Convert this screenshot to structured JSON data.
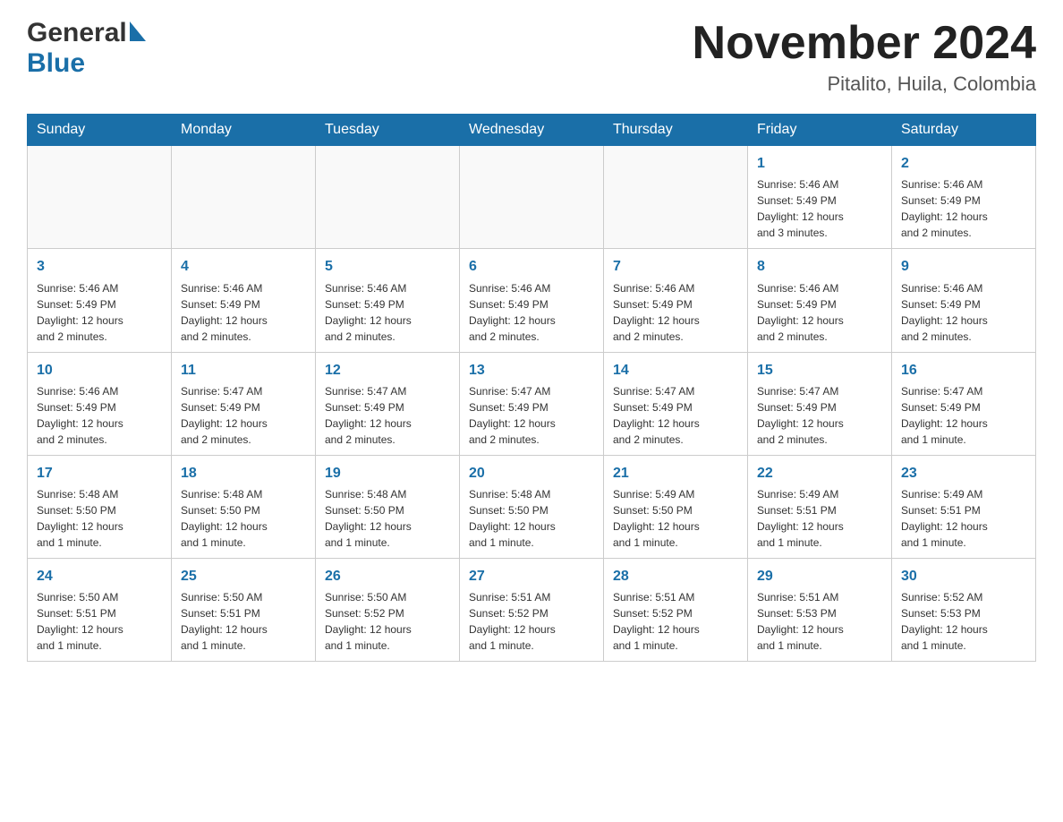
{
  "header": {
    "month_year": "November 2024",
    "location": "Pitalito, Huila, Colombia",
    "logo_general": "General",
    "logo_blue": "Blue"
  },
  "weekdays": [
    "Sunday",
    "Monday",
    "Tuesday",
    "Wednesday",
    "Thursday",
    "Friday",
    "Saturday"
  ],
  "weeks": [
    {
      "days": [
        {
          "num": "",
          "info": ""
        },
        {
          "num": "",
          "info": ""
        },
        {
          "num": "",
          "info": ""
        },
        {
          "num": "",
          "info": ""
        },
        {
          "num": "",
          "info": ""
        },
        {
          "num": "1",
          "info": "Sunrise: 5:46 AM\nSunset: 5:49 PM\nDaylight: 12 hours\nand 3 minutes."
        },
        {
          "num": "2",
          "info": "Sunrise: 5:46 AM\nSunset: 5:49 PM\nDaylight: 12 hours\nand 2 minutes."
        }
      ]
    },
    {
      "days": [
        {
          "num": "3",
          "info": "Sunrise: 5:46 AM\nSunset: 5:49 PM\nDaylight: 12 hours\nand 2 minutes."
        },
        {
          "num": "4",
          "info": "Sunrise: 5:46 AM\nSunset: 5:49 PM\nDaylight: 12 hours\nand 2 minutes."
        },
        {
          "num": "5",
          "info": "Sunrise: 5:46 AM\nSunset: 5:49 PM\nDaylight: 12 hours\nand 2 minutes."
        },
        {
          "num": "6",
          "info": "Sunrise: 5:46 AM\nSunset: 5:49 PM\nDaylight: 12 hours\nand 2 minutes."
        },
        {
          "num": "7",
          "info": "Sunrise: 5:46 AM\nSunset: 5:49 PM\nDaylight: 12 hours\nand 2 minutes."
        },
        {
          "num": "8",
          "info": "Sunrise: 5:46 AM\nSunset: 5:49 PM\nDaylight: 12 hours\nand 2 minutes."
        },
        {
          "num": "9",
          "info": "Sunrise: 5:46 AM\nSunset: 5:49 PM\nDaylight: 12 hours\nand 2 minutes."
        }
      ]
    },
    {
      "days": [
        {
          "num": "10",
          "info": "Sunrise: 5:46 AM\nSunset: 5:49 PM\nDaylight: 12 hours\nand 2 minutes."
        },
        {
          "num": "11",
          "info": "Sunrise: 5:47 AM\nSunset: 5:49 PM\nDaylight: 12 hours\nand 2 minutes."
        },
        {
          "num": "12",
          "info": "Sunrise: 5:47 AM\nSunset: 5:49 PM\nDaylight: 12 hours\nand 2 minutes."
        },
        {
          "num": "13",
          "info": "Sunrise: 5:47 AM\nSunset: 5:49 PM\nDaylight: 12 hours\nand 2 minutes."
        },
        {
          "num": "14",
          "info": "Sunrise: 5:47 AM\nSunset: 5:49 PM\nDaylight: 12 hours\nand 2 minutes."
        },
        {
          "num": "15",
          "info": "Sunrise: 5:47 AM\nSunset: 5:49 PM\nDaylight: 12 hours\nand 2 minutes."
        },
        {
          "num": "16",
          "info": "Sunrise: 5:47 AM\nSunset: 5:49 PM\nDaylight: 12 hours\nand 1 minute."
        }
      ]
    },
    {
      "days": [
        {
          "num": "17",
          "info": "Sunrise: 5:48 AM\nSunset: 5:50 PM\nDaylight: 12 hours\nand 1 minute."
        },
        {
          "num": "18",
          "info": "Sunrise: 5:48 AM\nSunset: 5:50 PM\nDaylight: 12 hours\nand 1 minute."
        },
        {
          "num": "19",
          "info": "Sunrise: 5:48 AM\nSunset: 5:50 PM\nDaylight: 12 hours\nand 1 minute."
        },
        {
          "num": "20",
          "info": "Sunrise: 5:48 AM\nSunset: 5:50 PM\nDaylight: 12 hours\nand 1 minute."
        },
        {
          "num": "21",
          "info": "Sunrise: 5:49 AM\nSunset: 5:50 PM\nDaylight: 12 hours\nand 1 minute."
        },
        {
          "num": "22",
          "info": "Sunrise: 5:49 AM\nSunset: 5:51 PM\nDaylight: 12 hours\nand 1 minute."
        },
        {
          "num": "23",
          "info": "Sunrise: 5:49 AM\nSunset: 5:51 PM\nDaylight: 12 hours\nand 1 minute."
        }
      ]
    },
    {
      "days": [
        {
          "num": "24",
          "info": "Sunrise: 5:50 AM\nSunset: 5:51 PM\nDaylight: 12 hours\nand 1 minute."
        },
        {
          "num": "25",
          "info": "Sunrise: 5:50 AM\nSunset: 5:51 PM\nDaylight: 12 hours\nand 1 minute."
        },
        {
          "num": "26",
          "info": "Sunrise: 5:50 AM\nSunset: 5:52 PM\nDaylight: 12 hours\nand 1 minute."
        },
        {
          "num": "27",
          "info": "Sunrise: 5:51 AM\nSunset: 5:52 PM\nDaylight: 12 hours\nand 1 minute."
        },
        {
          "num": "28",
          "info": "Sunrise: 5:51 AM\nSunset: 5:52 PM\nDaylight: 12 hours\nand 1 minute."
        },
        {
          "num": "29",
          "info": "Sunrise: 5:51 AM\nSunset: 5:53 PM\nDaylight: 12 hours\nand 1 minute."
        },
        {
          "num": "30",
          "info": "Sunrise: 5:52 AM\nSunset: 5:53 PM\nDaylight: 12 hours\nand 1 minute."
        }
      ]
    }
  ]
}
